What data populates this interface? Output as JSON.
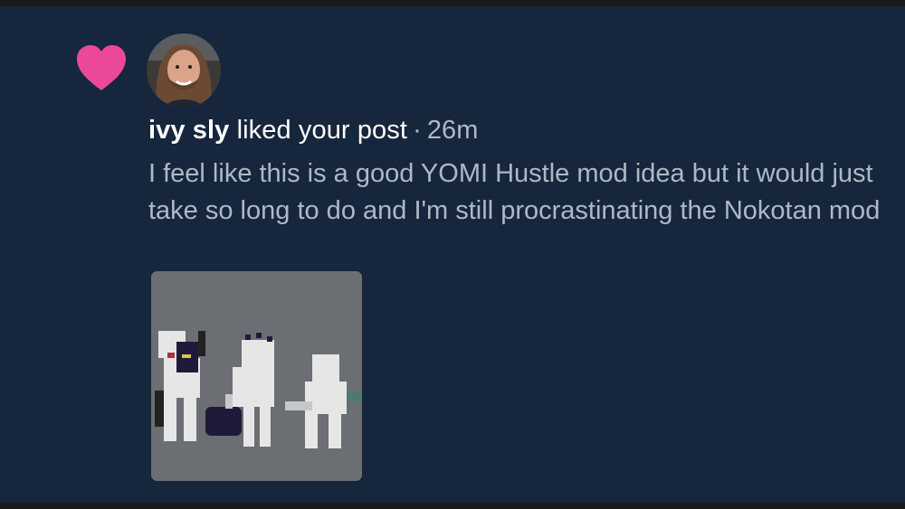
{
  "notification": {
    "type_icon": "heart-icon",
    "avatar_icon": "user-avatar",
    "user_name": "ivy sly",
    "action": "liked your post",
    "separator": "·",
    "time_ago": "26m",
    "post_excerpt": "I feel like this is a good YOMI Hustle mod idea but it would just take so long to do and I'm still procrastinating the Nokotan mod",
    "attachment": "pixel-art-image"
  },
  "colors": {
    "background": "#16263c",
    "heart": "#ec4899",
    "text_primary": "#ffffff",
    "text_secondary": "#aeb9c6"
  }
}
